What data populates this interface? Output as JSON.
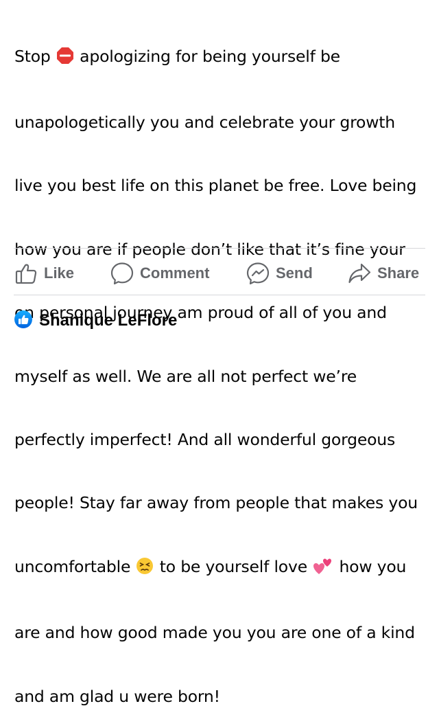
{
  "post": {
    "lines": [
      {
        "before": "Stop ",
        "emoji": "stop-sign-emoji",
        "after": " apologizing for being yourself be"
      },
      {
        "text": "unapologetically you and celebrate your growth"
      },
      {
        "text": "live you best life on this planet be free. Love being"
      },
      {
        "text": "how you are if people don’t like that it’s fine your"
      },
      {
        "text": "on personal journey am proud of all of you and"
      },
      {
        "text": "myself as well. We are all not perfect we’re"
      },
      {
        "text": "perfectly imperfect! And all wonderful gorgeous"
      },
      {
        "text": "people! Stay far away from people that makes you"
      },
      {
        "before": "uncomfortable ",
        "emoji": "persevering-face-emoji",
        "after": " to be yourself love ",
        "emoji2": "two-hearts-emoji",
        "after2": " how you"
      },
      {
        "text": "are and how good made you you are one of a kind"
      },
      {
        "text": "and am glad u were born!"
      }
    ]
  },
  "actions": {
    "like": {
      "label": "Like",
      "icon": "thumbs-up-outline-icon"
    },
    "comment": {
      "label": "Comment",
      "icon": "comment-bubble-icon"
    },
    "send": {
      "label": "Send",
      "icon": "messenger-icon"
    },
    "share": {
      "label": "Share",
      "icon": "share-arrow-icon"
    }
  },
  "reaction": {
    "icon": "like-reaction-badge-icon",
    "name": "Shanique LeFlore"
  },
  "colors": {
    "text": "#050505",
    "muted": "#65676b",
    "divider": "#d6d7da",
    "like_blue": "#1877f2",
    "stop_red": "#e53935",
    "heart_pink": "#f06292"
  }
}
